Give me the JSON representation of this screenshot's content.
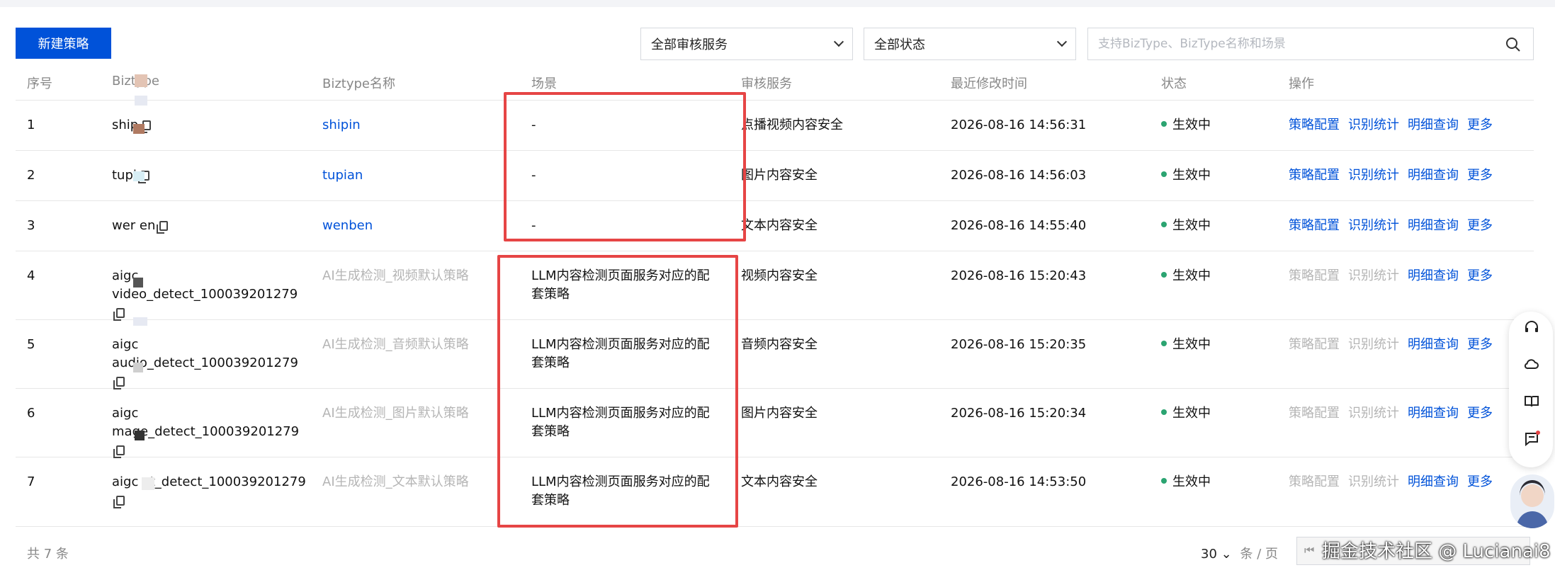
{
  "toolbar": {
    "new_button": "新建策略",
    "service_select": "全部审核服务",
    "status_select": "全部状态",
    "search_placeholder": "支持BizType、BizType名称和场景"
  },
  "table": {
    "headers": [
      "序号",
      "Biztype",
      "Biztype名称",
      "场景",
      "审核服务",
      "最近修改时间",
      "状态",
      "操作"
    ],
    "rows": [
      {
        "no": "1",
        "biztype": "ship",
        "name": "shipin",
        "scene": "-",
        "service": "点播视频内容安全",
        "time": "2026-08-16 14:56:31",
        "status": "生效中",
        "op1": "策略配置",
        "op2": "识别统计",
        "op3": "明细查询",
        "op4": "更多"
      },
      {
        "no": "2",
        "biztype": "tupi",
        "name": "tupian",
        "scene": "-",
        "service": "图片内容安全",
        "time": "2026-08-16 14:56:03",
        "status": "生效中",
        "op1": "策略配置",
        "op2": "识别统计",
        "op3": "明细查询",
        "op4": "更多"
      },
      {
        "no": "3",
        "biztype": "wer  en",
        "name": "wenben",
        "scene": "-",
        "service": "文本内容安全",
        "time": "2026-08-16 14:55:40",
        "status": "生效中",
        "op1": "策略配置",
        "op2": "识别统计",
        "op3": "明细查询",
        "op4": "更多"
      },
      {
        "no": "4",
        "biztype": "aigc video_detect_100039201279",
        "name": "AI生成检测_视频默认策略",
        "scene": "LLM内容检测页面服务对应的配套策略",
        "service": "视频内容安全",
        "time": "2026-08-16 15:20:43",
        "status": "生效中",
        "op1": "策略配置",
        "op2": "识别统计",
        "op3": "明细查询",
        "op4": "更多"
      },
      {
        "no": "5",
        "biztype": "aigc audio_detect_100039201279",
        "name": "AI生成检测_音频默认策略",
        "scene": "LLM内容检测页面服务对应的配套策略",
        "service": "音频内容安全",
        "time": "2026-08-16 15:20:35",
        "status": "生效中",
        "op1": "策略配置",
        "op2": "识别统计",
        "op3": "明细查询",
        "op4": "更多"
      },
      {
        "no": "6",
        "biztype": "aigc mage_detect_100039201279",
        "name": "AI生成检测_图片默认策略",
        "scene": "LLM内容检测页面服务对应的配套策略",
        "service": "图片内容安全",
        "time": "2026-08-16 15:20:34",
        "status": "生效中",
        "op1": "策略配置",
        "op2": "识别统计",
        "op3": "明细查询",
        "op4": "更多"
      },
      {
        "no": "7",
        "biztype": "aigc xt_detect_100039201279",
        "name": "AI生成检测_文本默认策略",
        "scene": "LLM内容检测页面服务对应的配套策略",
        "service": "文本内容安全",
        "time": "2026-08-16 14:53:50",
        "status": "生效中",
        "op1": "策略配置",
        "op2": "识别统计",
        "op3": "明细查询",
        "op4": "更多"
      }
    ]
  },
  "footer": {
    "total": "共 7 条",
    "page_size": "30",
    "page_size_unit": "条 / 页",
    "watermark": "掘金技术社区 @ Lucianai8"
  },
  "colors": {
    "primary": "#0052d9",
    "status_active": "#2ba471",
    "highlight_box": "#e64545"
  }
}
